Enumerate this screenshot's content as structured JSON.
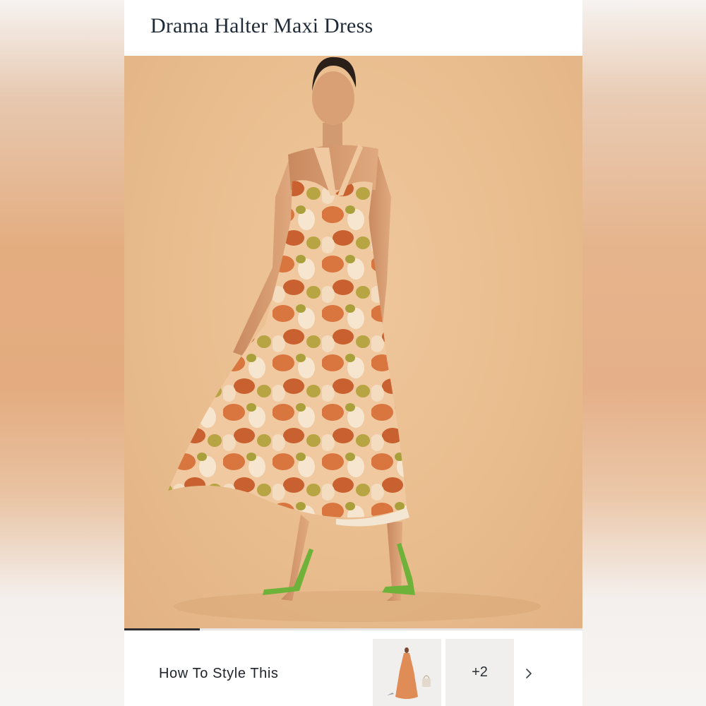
{
  "product": {
    "title": "Drama Halter Maxi Dress"
  },
  "gallery": {
    "image_description": "Model wearing orange floral halter maxi dress with green strappy heels",
    "progress_fraction": 0.165
  },
  "style_section": {
    "label": "How To Style This",
    "more_count": "+2"
  },
  "icons": {
    "next": "chevron-right-icon"
  },
  "colors": {
    "title_text": "#1f2a36",
    "backdrop": "#e9bd8e",
    "progress_fill": "#2b2f33"
  }
}
